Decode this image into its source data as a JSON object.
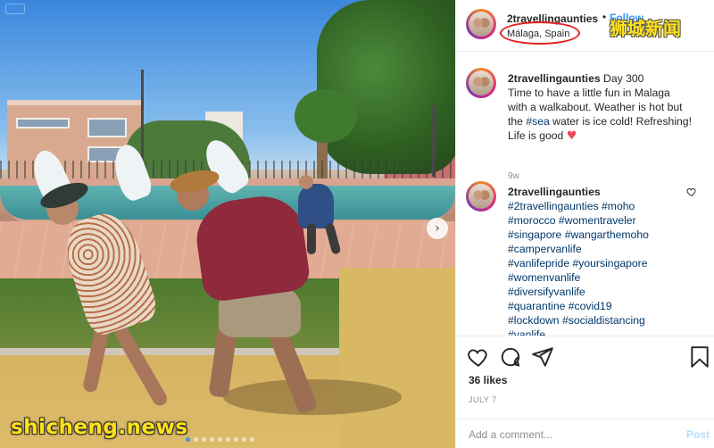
{
  "post": {
    "username": "2travellingaunties",
    "follow_label": "Follow",
    "separator": "•",
    "location": "Málaga, Spain"
  },
  "comments": [
    {
      "username": "2travellingaunties",
      "lead": "Day 300",
      "line1": "Time to have a little fun in Malaga",
      "line2": "with a walkabout. Weather is hot but",
      "line3_pre": "the ",
      "line3_tag": "#sea",
      "line3_post": " water is ice cold! Refreshing!",
      "line4": "Life is good",
      "emoji": "♥",
      "age": "9w"
    },
    {
      "username": "2travellingaunties",
      "tags": [
        [
          "#2travellingaunties",
          "#moho"
        ],
        [
          "#morocco",
          "#womentraveler"
        ],
        [
          "#singapore",
          "#wangarthemoho"
        ],
        [
          "#campervanlife"
        ],
        [
          "#vanlifepride",
          "#yoursingapore"
        ],
        [
          "#womenvanlife"
        ],
        [
          "#diversifyvanlife"
        ],
        [
          "#quarantine",
          "#covid19"
        ],
        [
          "#lockdown",
          "#socialdistancing"
        ],
        [
          "#vanlife"
        ]
      ]
    }
  ],
  "icons": {
    "like": "heart-outline-icon",
    "comment": "speech-bubble-icon",
    "share": "paper-plane-icon",
    "save": "bookmark-icon",
    "next": "chevron-right-icon",
    "comment_like": "small-heart-icon"
  },
  "stats": {
    "likes": "36 likes",
    "date": "JULY 7"
  },
  "composer": {
    "placeholder": "Add a comment...",
    "post_label": "Post"
  },
  "carousel": {
    "total": 9,
    "active_index": 0,
    "next_glyph": "›"
  },
  "watermarks": {
    "top_right": "狮城新闻",
    "bottom_left": "shicheng.news"
  },
  "colors": {
    "link_blue": "#3897f0",
    "hashtag": "#00376b",
    "watermark_yellow": "#ffe11a",
    "annotation_red": "#e0201b"
  }
}
